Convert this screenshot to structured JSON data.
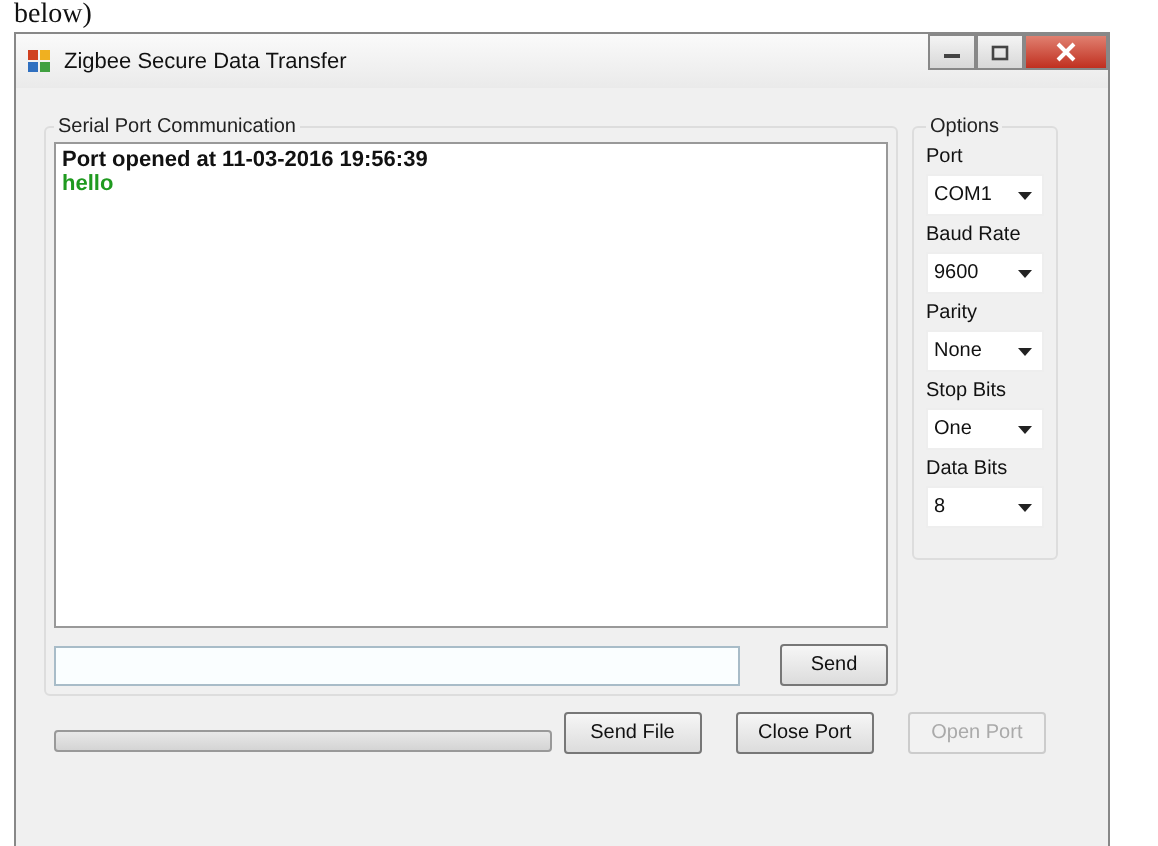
{
  "document_text": "below)",
  "window": {
    "title": "Zigbee Secure Data Transfer"
  },
  "communication": {
    "title": "Serial Port Communication",
    "log": [
      {
        "text": "Port opened at 11-03-2016 19:56:39",
        "kind": "status"
      },
      {
        "text": "hello",
        "kind": "message"
      }
    ],
    "send_button": "Send"
  },
  "options": {
    "title": "Options",
    "fields": [
      {
        "label": "Port",
        "value": "COM1"
      },
      {
        "label": "Baud Rate",
        "value": "9600"
      },
      {
        "label": "Parity",
        "value": "None"
      },
      {
        "label": "Stop Bits",
        "value": "One"
      },
      {
        "label": "Data Bits",
        "value": "8"
      }
    ]
  },
  "progress": {
    "level": 0
  },
  "buttons": [
    {
      "label": "Send File",
      "disabled": false
    },
    {
      "label": "Close Port",
      "disabled": false
    },
    {
      "label": "Open Port",
      "disabled": true
    }
  ]
}
